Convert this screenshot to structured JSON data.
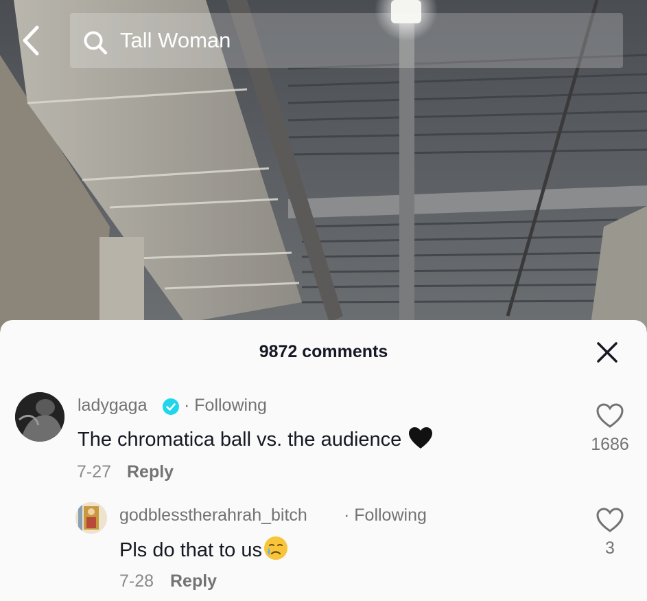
{
  "search": {
    "query": "Tall Woman"
  },
  "comments_panel": {
    "count_label": "9872 comments"
  },
  "comments": [
    {
      "username": "ladygaga",
      "follow_status": "· Following",
      "text": "The chromatica ball vs. the audience",
      "emoji": "black-heart",
      "date": "7-27",
      "reply_label": "Reply",
      "likes": "1686",
      "verified": true
    },
    {
      "username": "godblesstherahrah_bitch",
      "follow_status": "· Following",
      "text": "Pls do that to us",
      "emoji": "face-holding-back-tears",
      "date": "7-28",
      "reply_label": "Reply",
      "likes": "3",
      "verified": false
    }
  ],
  "colors": {
    "verified": "#20d5ec",
    "text_primary": "#161823",
    "text_secondary": "#737373",
    "sheet_bg": "#fafafa"
  }
}
